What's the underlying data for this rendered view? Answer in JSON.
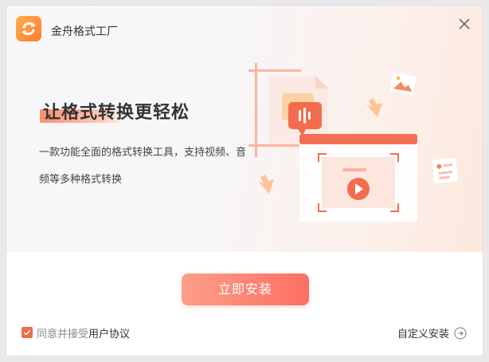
{
  "app": {
    "title": "金舟格式工厂"
  },
  "hero": {
    "headline": "让格式转换更轻松",
    "subtitle": "一款功能全面的格式转换工具，支持视频、音频等多种格式转换"
  },
  "actions": {
    "install_label": "立即安装",
    "agree_prefix": "同意并接受",
    "agree_link": "用户协议",
    "agree_checked": true,
    "custom_install_label": "自定义安装"
  },
  "colors": {
    "accent": "#f26b4a",
    "button_start": "#fd9f87",
    "button_end": "#fd6e63"
  },
  "icons": {
    "logo": "app-logo-icon",
    "close": "close-icon",
    "custom_install": "arrow-right-circle-icon"
  }
}
